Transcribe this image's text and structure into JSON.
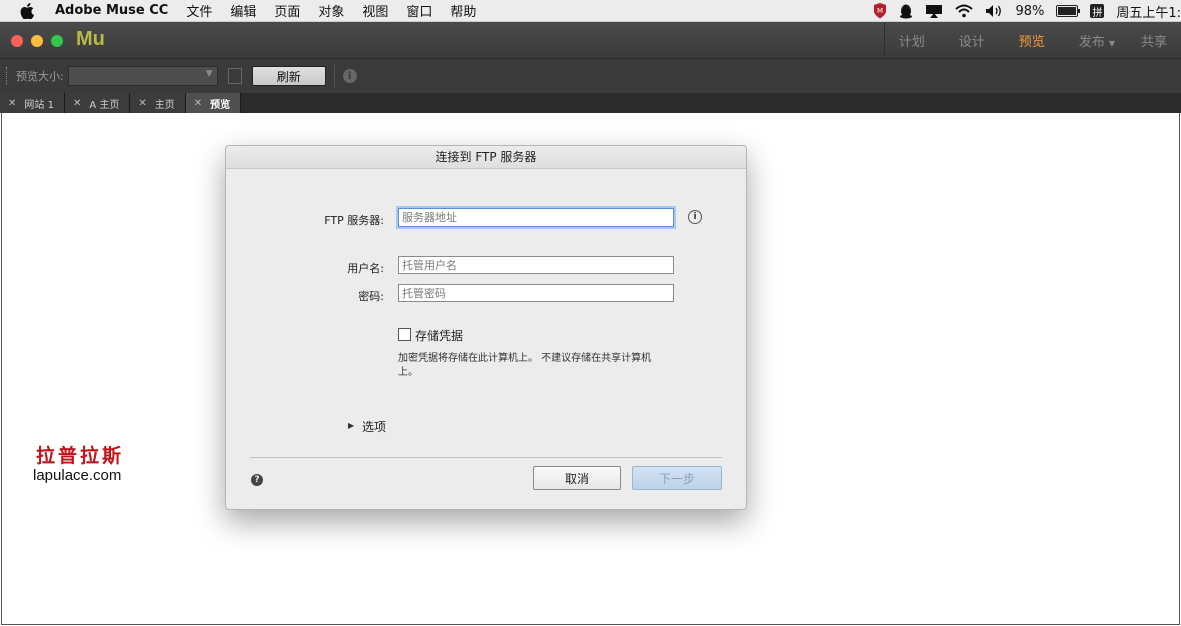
{
  "menubar": {
    "app_name": "Adobe Muse CC",
    "items": [
      "文件",
      "编辑",
      "页面",
      "对象",
      "视图",
      "窗口",
      "帮助"
    ],
    "battery": "98%",
    "battery_level": 0.98,
    "input_method": "拼",
    "clock": "周五上午1:"
  },
  "app": {
    "logo": "Mu",
    "modes": [
      {
        "label": "计划"
      },
      {
        "label": "设计"
      },
      {
        "label": "预览"
      },
      {
        "label": "发布"
      },
      {
        "label": "共享"
      }
    ],
    "active_mode": "预览",
    "accent_color": "#f09a3c"
  },
  "toolbar": {
    "preview_size_label": "预览大小:",
    "preview_size_value": "",
    "refresh_label": "刷新"
  },
  "tabs": [
    {
      "label": "网站 1"
    },
    {
      "label": "A 主页"
    },
    {
      "label": "主页"
    },
    {
      "label": "预览"
    }
  ],
  "dialog": {
    "title": "连接到 FTP 服务器",
    "ftp_label": "FTP 服务器:",
    "ftp_placeholder": "服务器地址",
    "username_label": "用户名:",
    "username_placeholder": "托管用户名",
    "password_label": "密码:",
    "password_placeholder": "托管密码",
    "save_credentials_label": "存储凭据",
    "save_credentials_checked": false,
    "save_note": "加密凭据将存储在此计算机上。 不建议存储在共享计算机上。",
    "options_label": "选项",
    "cancel_label": "取消",
    "next_label": "下一步"
  },
  "watermark": {
    "chinese": "拉普拉斯",
    "url": "lapulace.com"
  }
}
